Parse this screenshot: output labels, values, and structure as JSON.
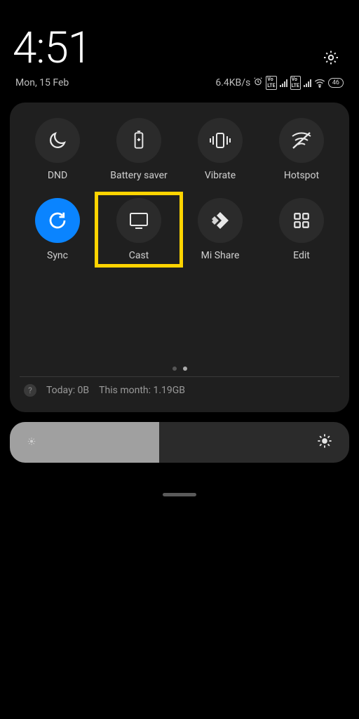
{
  "statusbar": {
    "time": "4:51",
    "date": "Mon, 15 Feb",
    "net_speed": "6.4KB/s",
    "battery_level": "46"
  },
  "tiles": [
    {
      "id": "dnd",
      "label": "DND",
      "icon": "moon",
      "active": false
    },
    {
      "id": "battery",
      "label": "Battery saver",
      "icon": "battery",
      "active": false
    },
    {
      "id": "vibrate",
      "label": "Vibrate",
      "icon": "vibrate",
      "active": false
    },
    {
      "id": "hotspot",
      "label": "Hotspot",
      "icon": "hotspot",
      "active": false
    },
    {
      "id": "sync",
      "label": "Sync",
      "icon": "sync",
      "active": true
    },
    {
      "id": "cast",
      "label": "Cast",
      "icon": "cast",
      "active": false,
      "highlighted": true
    },
    {
      "id": "mishare",
      "label": "Mi Share",
      "icon": "mishare",
      "active": false
    },
    {
      "id": "edit",
      "label": "Edit",
      "icon": "edit",
      "active": false
    }
  ],
  "data_usage": {
    "today": "Today: 0B",
    "month": "This month: 1.19GB"
  },
  "brightness_percent": 44,
  "colors": {
    "panel_bg": "#1f1f1f",
    "tile_bg": "#2b2b2b",
    "accent": "#0a84ff",
    "highlight": "#ffd400"
  }
}
